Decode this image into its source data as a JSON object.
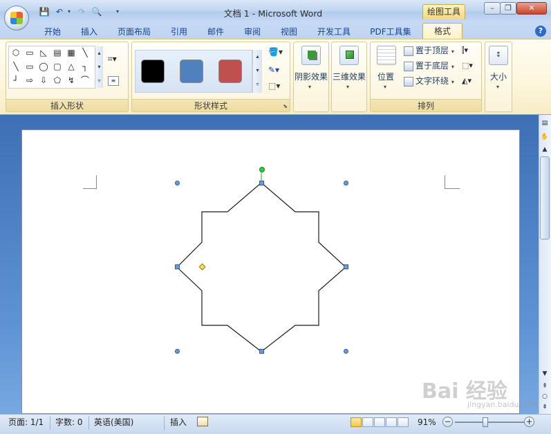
{
  "window": {
    "title": "文档 1 - Microsoft Word",
    "context_tab": "绘图工具",
    "controls": {
      "minimize": "–",
      "restore": "❐",
      "close": "✕"
    }
  },
  "quick_access": {
    "icons": [
      "save-icon",
      "undo-icon",
      "redo-icon",
      "print-preview-icon",
      "customize-icon"
    ]
  },
  "tabs": [
    {
      "label": "开始"
    },
    {
      "label": "插入"
    },
    {
      "label": "页面布局"
    },
    {
      "label": "引用"
    },
    {
      "label": "邮件"
    },
    {
      "label": "审阅"
    },
    {
      "label": "视图"
    },
    {
      "label": "开发工具"
    },
    {
      "label": "PDF工具集"
    },
    {
      "label": "格式"
    }
  ],
  "help_label": "?",
  "ribbon": {
    "insert_shapes": {
      "label": "插入形状",
      "shapes": [
        "⬡",
        "▭",
        "◺",
        "▤",
        "▦",
        "╲",
        "╲",
        "▭",
        "◯",
        "▢",
        "△",
        "┐",
        "┘",
        "⇨",
        "⇩",
        "⬠",
        "↯",
        "⌒"
      ]
    },
    "shape_styles": {
      "label": "形状样式",
      "swatches": [
        "#000000",
        "#4f81bd",
        "#c0504d"
      ]
    },
    "shadow": {
      "label": "阴影效果"
    },
    "threed": {
      "label": "三维效果"
    },
    "arrange": {
      "label": "排列",
      "position": "位置",
      "bring_front": "置于顶层",
      "send_back": "置于底层",
      "text_wrap": "文字环绕"
    },
    "size": {
      "label": "大小"
    }
  },
  "status": {
    "page": "页面: 1/1",
    "words": "字数: 0",
    "language": "英语(美国)",
    "mode": "插入",
    "zoom": "91%"
  },
  "watermark": {
    "text": "Bai 经验",
    "sub": "jingyan.baidu.com"
  },
  "colors": {
    "accent": "#15428b",
    "ribbon_bg": "#fcf6dd",
    "handle": "#6b9bd1",
    "rotation_handle": "#2ecc40",
    "adjust_handle": "#f7e45b"
  }
}
